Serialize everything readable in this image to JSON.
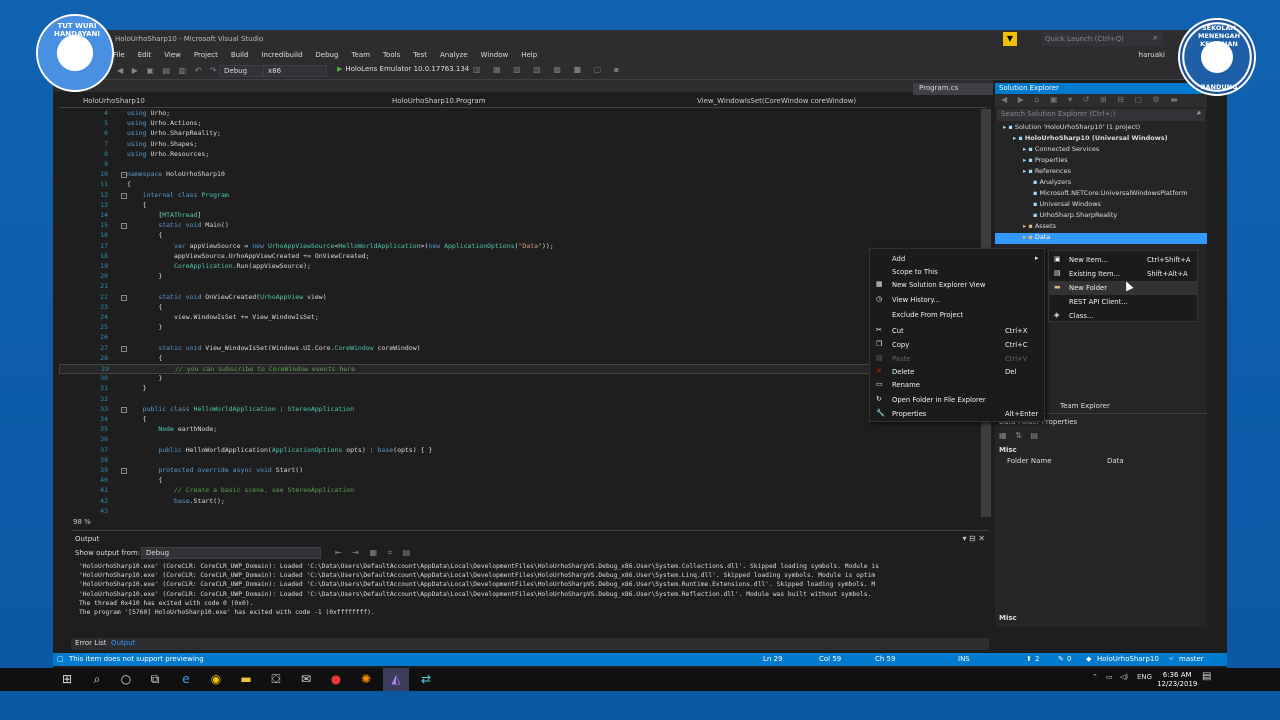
{
  "window": {
    "title": "HoloUrhoSharp10 - Microsoft Visual Studio",
    "quick_launch": "Quick Launch (Ctrl+Q)",
    "user": "haruaki",
    "menu": [
      "File",
      "Edit",
      "View",
      "Project",
      "Build",
      "Incredibuild",
      "Debug",
      "Team",
      "Tools",
      "Test",
      "Analyze",
      "Window",
      "Help"
    ]
  },
  "toolbar": {
    "config": "Debug",
    "platform": "x86",
    "run_target": "HoloLens Emulator 10.0.17763.134"
  },
  "editor": {
    "tab": "Program.cs",
    "nav": {
      "project": "HoloUrhoSharp10",
      "class": "HoloUrhoSharp10.Program",
      "member": "View_WindowIsSet(CoreWindow coreWindow)"
    },
    "zoom": "98 %",
    "lines": [
      {
        "n": "4",
        "html": "<span class='kw'>using</span> <span class='pl'>Urho;</span>"
      },
      {
        "n": "5",
        "html": "<span class='kw'>using</span> <span class='pl'>Urho.Actions;</span>"
      },
      {
        "n": "6",
        "html": "<span class='kw'>using</span> <span class='pl'>Urho.SharpReality;</span>"
      },
      {
        "n": "7",
        "html": "<span class='kw'>using</span> <span class='pl'>Urho.Shapes;</span>"
      },
      {
        "n": "8",
        "html": "<span class='kw'>using</span> <span class='pl'>Urho.Resources;</span>"
      },
      {
        "n": "9",
        "html": ""
      },
      {
        "n": "10",
        "html": "<span class='kw'>namespace</span> <span class='pl'>HoloUrhoSharp10</span>"
      },
      {
        "n": "11",
        "html": "<span class='pl'>{</span>"
      },
      {
        "n": "12",
        "html": "    <span class='kw'>internal class</span> <span class='ty'>Program</span>"
      },
      {
        "n": "13",
        "html": "    <span class='pl'>{</span>"
      },
      {
        "n": "14",
        "html": "        <span class='pl'>[</span><span class='ty'>MTAThread</span><span class='pl'>]</span>"
      },
      {
        "n": "15",
        "html": "        <span class='kw'>static void</span> <span class='pl'>Main()</span>"
      },
      {
        "n": "16",
        "html": "        <span class='pl'>{</span>"
      },
      {
        "n": "17",
        "html": "            <span class='kw'>var</span> <span class='pl'>appViewSource = </span><span class='kw'>new</span> <span class='ty'>UrhoAppViewSource</span><span class='pl'>&lt;</span><span class='ty'>HelloWorldApplication</span><span class='pl'>&gt;(</span><span class='kw'>new</span> <span class='ty'>ApplicationOptions</span><span class='pl'>(</span><span class='st'>\"Data\"</span><span class='pl'>));</span>"
      },
      {
        "n": "18",
        "html": "            <span class='pl'>appViewSource.UrhoAppViewCreated += OnViewCreated;</span>"
      },
      {
        "n": "19",
        "html": "            <span class='ty'>CoreApplication</span><span class='pl'>.Run(appViewSource);</span>"
      },
      {
        "n": "20",
        "html": "        <span class='pl'>}</span>"
      },
      {
        "n": "21",
        "html": ""
      },
      {
        "n": "22",
        "html": "        <span class='kw'>static void</span> <span class='pl'>OnViewCreated(</span><span class='ty'>UrhoAppView</span> <span class='pl'>view)</span>"
      },
      {
        "n": "23",
        "html": "        <span class='pl'>{</span>"
      },
      {
        "n": "24",
        "html": "            <span class='pl'>view.WindowIsSet += View_WindowIsSet;</span>"
      },
      {
        "n": "25",
        "html": "        <span class='pl'>}</span>"
      },
      {
        "n": "26",
        "html": ""
      },
      {
        "n": "27",
        "html": "        <span class='kw'>static void</span> <span class='pl'>View_WindowIsSet(Windows.UI.Core.</span><span class='ty'>CoreWindow</span> <span class='pl'>coreWindow)</span>"
      },
      {
        "n": "28",
        "html": "        <span class='pl'>{</span>"
      },
      {
        "n": "29",
        "html": "            <span class='cm'>// you can subscribe to CoreWindow events here</span>"
      },
      {
        "n": "30",
        "html": "        <span class='pl'>}</span>"
      },
      {
        "n": "31",
        "html": "    <span class='pl'>}</span>"
      },
      {
        "n": "32",
        "html": ""
      },
      {
        "n": "33",
        "html": "    <span class='kw'>public class</span> <span class='ty'>HelloWorldApplication</span> <span class='pl'>: </span><span class='ty'>StereoApplication</span>"
      },
      {
        "n": "34",
        "html": "    <span class='pl'>{</span>"
      },
      {
        "n": "35",
        "html": "        <span class='ty'>Node</span> <span class='pl'>earthNode;</span>"
      },
      {
        "n": "36",
        "html": ""
      },
      {
        "n": "37",
        "html": "        <span class='kw'>public</span> <span class='pl'>HelloWorldApplication(</span><span class='ty'>ApplicationOptions</span> <span class='pl'>opts) : </span><span class='kw'>base</span><span class='pl'>(opts) { }</span>"
      },
      {
        "n": "38",
        "html": ""
      },
      {
        "n": "39",
        "html": "        <span class='kw'>protected override async void</span> <span class='pl'>Start()</span>"
      },
      {
        "n": "40",
        "html": "        <span class='pl'>{</span>"
      },
      {
        "n": "41",
        "html": "            <span class='cm'>// Create a basic scene, see StereoApplication</span>"
      },
      {
        "n": "42",
        "html": "            <span class='kw'>base</span><span class='pl'>.Start();</span>"
      },
      {
        "n": "43",
        "html": ""
      }
    ]
  },
  "output": {
    "title": "Output",
    "show_from_label": "Show output from:",
    "show_from_value": "Debug",
    "text": "'HoloUrhoSharp10.exe' (CoreCLR: CoreCLR_UWP_Domain): Loaded 'C:\\Data\\Users\\DefaultAccount\\AppData\\Local\\DevelopmentFiles\\HoloUrhoSharpVS.Debug_x86.User\\System.Collections.dll'. Skipped loading symbols. Module is\n'HoloUrhoSharp10.exe' (CoreCLR: CoreCLR_UWP_Domain): Loaded 'C:\\Data\\Users\\DefaultAccount\\AppData\\Local\\DevelopmentFiles\\HoloUrhoSharpVS.Debug_x86.User\\System.Linq.dll'. Skipped loading symbols. Module is optim\n'HoloUrhoSharp10.exe' (CoreCLR: CoreCLR_UWP_Domain): Loaded 'C:\\Data\\Users\\DefaultAccount\\AppData\\Local\\DevelopmentFiles\\HoloUrhoSharpVS.Debug_x86.User\\System.Runtime.Extensions.dll'. Skipped loading symbols. M\n'HoloUrhoSharp10.exe' (CoreCLR: CoreCLR_UWP_Domain): Loaded 'C:\\Data\\Users\\DefaultAccount\\AppData\\Local\\DevelopmentFiles\\HoloUrhoSharpVS.Debug_x86.User\\System.Reflection.dll'. Module was built without symbols.\nThe thread 0x410 has exited with code 0 (0x0).\nThe program '[5760] HoloUrhoSharp10.exe' has exited with code -1 (0xffffffff).",
    "tabs": [
      "Error List",
      "Output"
    ]
  },
  "solution_explorer": {
    "title": "Solution Explorer",
    "search_placeholder": "Search Solution Explorer (Ctrl+;)",
    "tree": [
      {
        "indent": 0,
        "label": "Solution 'HoloUrhoSharp10' (1 project)",
        "bold": false
      },
      {
        "indent": 1,
        "label": "HoloUrhoSharp10 (Universal Windows)",
        "bold": true
      },
      {
        "indent": 2,
        "label": "Connected Services",
        "bold": false
      },
      {
        "indent": 2,
        "label": "Properties",
        "bold": false
      },
      {
        "indent": 2,
        "label": "References",
        "bold": false
      },
      {
        "indent": 3,
        "label": "Analyzers",
        "bold": false
      },
      {
        "indent": 3,
        "label": "Microsoft.NETCore.UniversalWindowsPlatform",
        "bold": false
      },
      {
        "indent": 3,
        "label": "Universal Windows",
        "bold": false
      },
      {
        "indent": 3,
        "label": "UrhoSharp.SharpReality",
        "bold": false
      },
      {
        "indent": 2,
        "label": "Assets",
        "bold": false
      },
      {
        "indent": 2,
        "label": "Data",
        "bold": false,
        "selected": true
      }
    ],
    "team_explorer_tab": "Team Explorer"
  },
  "properties": {
    "title": "Data  Folder Properties",
    "section": "Misc",
    "rows": [
      {
        "name": "Folder Name",
        "value": "Data"
      }
    ],
    "desc_title": "Misc"
  },
  "context_menu": {
    "items": [
      {
        "label": "Add",
        "shortcut": "",
        "icon": "",
        "disabled": false
      },
      {
        "label": "Scope to This",
        "shortcut": "",
        "icon": "",
        "disabled": false
      },
      {
        "label": "New Solution Explorer View",
        "shortcut": "",
        "icon": "▦",
        "disabled": false
      },
      {
        "label": "View History...",
        "shortcut": "",
        "icon": "◷",
        "disabled": false
      },
      {
        "label": "Exclude From Project",
        "shortcut": "",
        "icon": "",
        "disabled": false
      },
      {
        "label": "Cut",
        "shortcut": "Ctrl+X",
        "icon": "✂",
        "disabled": false
      },
      {
        "label": "Copy",
        "shortcut": "Ctrl+C",
        "icon": "❐",
        "disabled": false
      },
      {
        "label": "Paste",
        "shortcut": "Ctrl+V",
        "icon": "▤",
        "disabled": true
      },
      {
        "label": "Delete",
        "shortcut": "Del",
        "icon": "✕",
        "disabled": false
      },
      {
        "label": "Rename",
        "shortcut": "",
        "icon": "▭",
        "disabled": false
      },
      {
        "label": "Open Folder in File Explorer",
        "shortcut": "",
        "icon": "↻",
        "disabled": false
      },
      {
        "label": "Properties",
        "shortcut": "Alt+Enter",
        "icon": "🔧",
        "disabled": false
      }
    ],
    "sub_items": [
      {
        "label": "New Item...",
        "shortcut": "Ctrl+Shift+A",
        "icon": "▣",
        "hover": false
      },
      {
        "label": "Existing Item...",
        "shortcut": "Shift+Alt+A",
        "icon": "▤",
        "hover": false
      },
      {
        "label": "New Folder",
        "shortcut": "",
        "icon": "▬",
        "hover": true
      },
      {
        "label": "REST API Client...",
        "shortcut": "",
        "icon": "",
        "hover": false
      },
      {
        "label": "Class...",
        "shortcut": "",
        "icon": "◈",
        "hover": false
      }
    ]
  },
  "status": {
    "message": "This item does not support previewing",
    "ln": "Ln 29",
    "col": "Col 59",
    "ch": "Ch 59",
    "mode": "INS",
    "up": "2",
    "pencil": "0",
    "repo": "HoloUrhoSharp10",
    "branch": "master"
  },
  "taskbar": {
    "lang": "ENG",
    "time": "6:36 AM",
    "date": "12/23/2019"
  },
  "logos": {
    "left": "TUT WURI HANDAYANI",
    "right_top": "SEKOLAH MENENGAH KEJURUAN",
    "right_bottom": "BANDUNG"
  }
}
